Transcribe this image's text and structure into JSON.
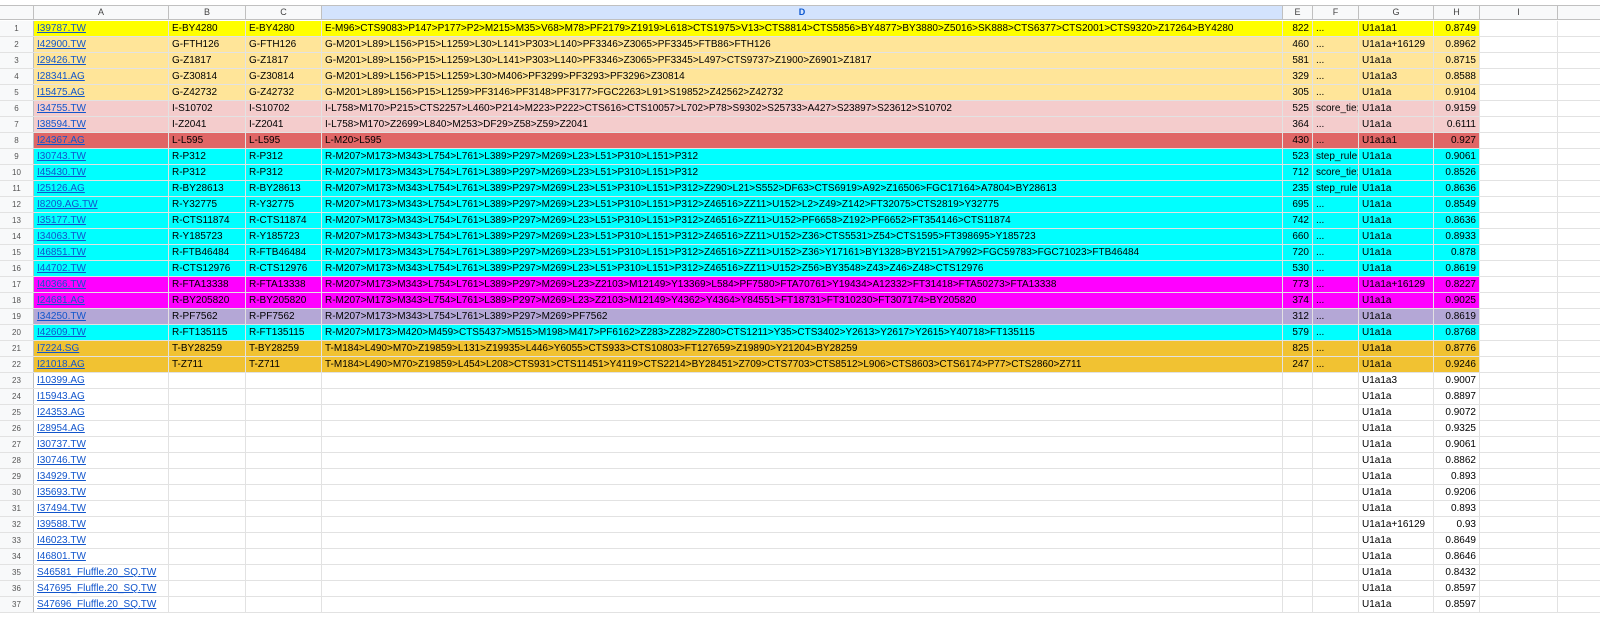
{
  "columns": [
    "A",
    "B",
    "C",
    "D",
    "E",
    "F",
    "G",
    "H",
    "I"
  ],
  "selected_column": "D",
  "colors": {
    "yellow": "#ffff00",
    "beige": "#ffe599",
    "pink": "#f4cccc",
    "red": "#e06666",
    "cyan": "#00ffff",
    "magenta": "#ff00ff",
    "lavender": "#b4a7d6",
    "orange": "#f1c232",
    "white": "#ffffff"
  },
  "rows": [
    {
      "n": "1",
      "a": "I39787.TW",
      "b": "E-BY4280",
      "c": "E-BY4280",
      "d": "E-M96>CTS9083>P147>P177>P2>M215>M35>V68>M78>PF2179>Z1919>L618>CTS1975>V13>CTS8814>CTS5856>BY4877>BY3880>Z5016>SK888>CTS6377>CTS2001>CTS9320>Z17264>BY4280",
      "e": "822",
      "f": "...",
      "g": "U1a1a1",
      "h": "0.8749",
      "color": "yellow"
    },
    {
      "n": "2",
      "a": "I42900.TW",
      "b": "G-FTH126",
      "c": "G-FTH126",
      "d": "G-M201>L89>L156>P15>L1259>L30>L141>P303>L140>PF3346>Z3065>PF3345>FTB86>FTH126",
      "e": "460",
      "f": "...",
      "g": "U1a1a+16129",
      "h": "0.8962",
      "color": "beige"
    },
    {
      "n": "3",
      "a": "I29426.TW",
      "b": "G-Z1817",
      "c": "G-Z1817",
      "d": "G-M201>L89>L156>P15>L1259>L30>L141>P303>L140>PF3346>Z3065>PF3345>L497>CTS9737>Z1900>Z6901>Z1817",
      "e": "581",
      "f": "...",
      "g": "U1a1a",
      "h": "0.8715",
      "color": "beige"
    },
    {
      "n": "4",
      "a": "I28341.AG",
      "b": "G-Z30814",
      "c": "G-Z30814",
      "d": "G-M201>L89>L156>P15>L1259>L30>M406>PF3299>PF3293>PF3296>Z30814",
      "e": "329",
      "f": "...",
      "g": "U1a1a3",
      "h": "0.8588",
      "color": "beige"
    },
    {
      "n": "5",
      "a": "I15475.AG",
      "b": "G-Z42732",
      "c": "G-Z42732",
      "d": "G-M201>L89>L156>P15>L1259>PF3146>PF3148>PF3177>FGC2263>L91>S19852>Z42562>Z42732",
      "e": "305",
      "f": "...",
      "g": "U1a1a",
      "h": "0.9104",
      "color": "beige"
    },
    {
      "n": "6",
      "a": "I34755.TW",
      "b": "I-S10702",
      "c": "I-S10702",
      "d": "I-L758>M170>P215>CTS2257>L460>P214>M223>P222>CTS616>CTS10057>L702>P78>S9302>S25733>A427>S23897>S23612>S10702",
      "e": "525",
      "f": "score_tie;",
      "g": "U1a1a",
      "h": "0.9159",
      "color": "pink"
    },
    {
      "n": "7",
      "a": "I38594.TW",
      "b": "I-Z2041",
      "c": "I-Z2041",
      "d": "I-L758>M170>Z2699>L840>M253>DF29>Z58>Z59>Z2041",
      "e": "364",
      "f": "...",
      "g": "U1a1a",
      "h": "0.6111",
      "color": "pink"
    },
    {
      "n": "8",
      "a": "I24367.AG",
      "b": "L-L595",
      "c": "L-L595",
      "d": "L-M20>L595",
      "e": "430",
      "f": "...",
      "g": "U1a1a1",
      "h": "0.927",
      "color": "red"
    },
    {
      "n": "9",
      "a": "I30743.TW",
      "b": "R-P312",
      "c": "R-P312",
      "d": "R-M207>M173>M343>L754>L761>L389>P297>M269>L23>L51>P310>L151>P312",
      "e": "523",
      "f": "step_rule",
      "g": "U1a1a",
      "h": "0.9061",
      "color": "cyan"
    },
    {
      "n": "10",
      "a": "I45430.TW",
      "b": "R-P312",
      "c": "R-P312",
      "d": "R-M207>M173>M343>L754>L761>L389>P297>M269>L23>L51>P310>L151>P312",
      "e": "712",
      "f": "score_tie;",
      "g": "U1a1a",
      "h": "0.8526",
      "color": "cyan"
    },
    {
      "n": "11",
      "a": "I25126.AG",
      "b": "R-BY28613",
      "c": "R-BY28613",
      "d": "R-M207>M173>M343>L754>L761>L389>P297>M269>L23>L51>P310>L151>P312>Z290>L21>S552>DF63>CTS6919>A92>Z16506>FGC17164>A7804>BY28613",
      "e": "235",
      "f": "step_rule",
      "g": "U1a1a",
      "h": "0.8636",
      "color": "cyan"
    },
    {
      "n": "12",
      "a": "I8209.AG.TW",
      "b": "R-Y32775",
      "c": "R-Y32775",
      "d": "R-M207>M173>M343>L754>L761>L389>P297>M269>L23>L51>P310>L151>P312>Z46516>ZZ11>U152>L2>Z49>Z142>FT32075>CTS2819>Y32775",
      "e": "695",
      "f": "...",
      "g": "U1a1a",
      "h": "0.8549",
      "color": "cyan"
    },
    {
      "n": "13",
      "a": "I35177.TW",
      "b": "R-CTS11874",
      "c": "R-CTS11874",
      "d": "R-M207>M173>M343>L754>L761>L389>P297>M269>L23>L51>P310>L151>P312>Z46516>ZZ11>U152>PF6658>Z192>PF6652>FT354146>CTS11874",
      "e": "742",
      "f": "...",
      "g": "U1a1a",
      "h": "0.8636",
      "color": "cyan"
    },
    {
      "n": "14",
      "a": "I34063.TW",
      "b": "R-Y185723",
      "c": "R-Y185723",
      "d": "R-M207>M173>M343>L754>L761>L389>P297>M269>L23>L51>P310>L151>P312>Z46516>ZZ11>U152>Z36>CTS5531>Z54>CTS1595>FT398695>Y185723",
      "e": "660",
      "f": "...",
      "g": "U1a1a",
      "h": "0.8933",
      "color": "cyan"
    },
    {
      "n": "15",
      "a": "I46851.TW",
      "b": "R-FTB46484",
      "c": "R-FTB46484",
      "d": "R-M207>M173>M343>L754>L761>L389>P297>M269>L23>L51>P310>L151>P312>Z46516>ZZ11>U152>Z36>Y17161>BY1328>BY2151>A7992>FGC59783>FGC71023>FTB46484",
      "e": "720",
      "f": "...",
      "g": "U1a1a",
      "h": "0.878",
      "color": "cyan"
    },
    {
      "n": "16",
      "a": "I44702.TW",
      "b": "R-CTS12976",
      "c": "R-CTS12976",
      "d": "R-M207>M173>M343>L754>L761>L389>P297>M269>L23>L51>P310>L151>P312>Z46516>ZZ11>U152>Z56>BY3548>Z43>Z46>Z48>CTS12976",
      "e": "530",
      "f": "...",
      "g": "U1a1a",
      "h": "0.8619",
      "color": "cyan"
    },
    {
      "n": "17",
      "a": "I40366.TW",
      "b": "R-FTA13338",
      "c": "R-FTA13338",
      "d": "R-M207>M173>M343>L754>L761>L389>P297>M269>L23>Z2103>M12149>Y13369>L584>PF7580>FTA70761>Y19434>A12332>FT31418>FTA50273>FTA13338",
      "e": "773",
      "f": "...",
      "g": "U1a1a+16129",
      "h": "0.8227",
      "color": "magenta"
    },
    {
      "n": "18",
      "a": "I24681.AG",
      "b": "R-BY205820",
      "c": "R-BY205820",
      "d": "R-M207>M173>M343>L754>L761>L389>P297>M269>L23>Z2103>M12149>Y4362>Y4364>Y84551>FT18731>FT310230>FT307174>BY205820",
      "e": "374",
      "f": "...",
      "g": "U1a1a",
      "h": "0.9025",
      "color": "magenta"
    },
    {
      "n": "19",
      "a": "I34250.TW",
      "b": "R-PF7562",
      "c": "R-PF7562",
      "d": "R-M207>M173>M343>L754>L761>L389>P297>M269>PF7562",
      "e": "312",
      "f": "...",
      "g": "U1a1a",
      "h": "0.8619",
      "color": "lavender"
    },
    {
      "n": "20",
      "a": "I42609.TW",
      "b": "R-FT135115",
      "c": "R-FT135115",
      "d": "R-M207>M173>M420>M459>CTS5437>M515>M198>M417>PF6162>Z283>Z282>Z280>CTS1211>Y35>CTS3402>Y2613>Y2617>Y2615>Y40718>FT135115",
      "e": "579",
      "f": "...",
      "g": "U1a1a",
      "h": "0.8768",
      "color": "cyan"
    },
    {
      "n": "21",
      "a": "I7224.SG",
      "b": "T-BY28259",
      "c": "T-BY28259",
      "d": "T-M184>L490>M70>Z19859>L131>Z19935>L446>Y6055>CTS933>CTS10803>FT127659>Z19890>Y21204>BY28259",
      "e": "825",
      "f": "...",
      "g": "U1a1a",
      "h": "0.8776",
      "color": "orange"
    },
    {
      "n": "22",
      "a": "I21018.AG",
      "b": "T-Z711",
      "c": "T-Z711",
      "d": "T-M184>L490>M70>Z19859>L454>L208>CTS931>CTS11451>Y4119>CTS2214>BY28451>Z709>CTS7703>CTS8512>L906>CTS8603>CTS6174>P77>CTS2860>Z711",
      "e": "247",
      "f": "...",
      "g": "U1a1a",
      "h": "0.9246",
      "color": "orange"
    },
    {
      "n": "23",
      "a": "I10399.AG",
      "b": "",
      "c": "",
      "d": "",
      "e": "",
      "f": "",
      "g": "U1a1a3",
      "h": "0.9007",
      "color": "white"
    },
    {
      "n": "24",
      "a": "I15943.AG",
      "b": "",
      "c": "",
      "d": "",
      "e": "",
      "f": "",
      "g": "U1a1a",
      "h": "0.8897",
      "color": "white"
    },
    {
      "n": "25",
      "a": "I24353.AG",
      "b": "",
      "c": "",
      "d": "",
      "e": "",
      "f": "",
      "g": "U1a1a",
      "h": "0.9072",
      "color": "white"
    },
    {
      "n": "26",
      "a": "I28954.AG",
      "b": "",
      "c": "",
      "d": "",
      "e": "",
      "f": "",
      "g": "U1a1a",
      "h": "0.9325",
      "color": "white"
    },
    {
      "n": "27",
      "a": "I30737.TW",
      "b": "",
      "c": "",
      "d": "",
      "e": "",
      "f": "",
      "g": "U1a1a",
      "h": "0.9061",
      "color": "white"
    },
    {
      "n": "28",
      "a": "I30746.TW",
      "b": "",
      "c": "",
      "d": "",
      "e": "",
      "f": "",
      "g": "U1a1a",
      "h": "0.8862",
      "color": "white"
    },
    {
      "n": "29",
      "a": "I34929.TW",
      "b": "",
      "c": "",
      "d": "",
      "e": "",
      "f": "",
      "g": "U1a1a",
      "h": "0.893",
      "color": "white"
    },
    {
      "n": "30",
      "a": "I35693.TW",
      "b": "",
      "c": "",
      "d": "",
      "e": "",
      "f": "",
      "g": "U1a1a",
      "h": "0.9206",
      "color": "white"
    },
    {
      "n": "31",
      "a": "I37494.TW",
      "b": "",
      "c": "",
      "d": "",
      "e": "",
      "f": "",
      "g": "U1a1a",
      "h": "0.893",
      "color": "white"
    },
    {
      "n": "32",
      "a": "I39588.TW",
      "b": "",
      "c": "",
      "d": "",
      "e": "",
      "f": "",
      "g": "U1a1a+16129",
      "h": "0.93",
      "color": "white"
    },
    {
      "n": "33",
      "a": "I46023.TW",
      "b": "",
      "c": "",
      "d": "",
      "e": "",
      "f": "",
      "g": "U1a1a",
      "h": "0.8649",
      "color": "white"
    },
    {
      "n": "34",
      "a": "I46801.TW",
      "b": "",
      "c": "",
      "d": "",
      "e": "",
      "f": "",
      "g": "U1a1a",
      "h": "0.8646",
      "color": "white"
    },
    {
      "n": "35",
      "a": "S46581_Fluffle.20_SQ.TW",
      "b": "",
      "c": "",
      "d": "",
      "e": "",
      "f": "",
      "g": "U1a1a",
      "h": "0.8432",
      "color": "white"
    },
    {
      "n": "36",
      "a": "S47695_Fluffle.20_SQ.TW",
      "b": "",
      "c": "",
      "d": "",
      "e": "",
      "f": "",
      "g": "U1a1a",
      "h": "0.8597",
      "color": "white"
    },
    {
      "n": "37",
      "a": "S47696_Fluffle.20_SQ.TW",
      "b": "",
      "c": "",
      "d": "",
      "e": "",
      "f": "",
      "g": "U1a1a",
      "h": "0.8597",
      "color": "white"
    }
  ]
}
